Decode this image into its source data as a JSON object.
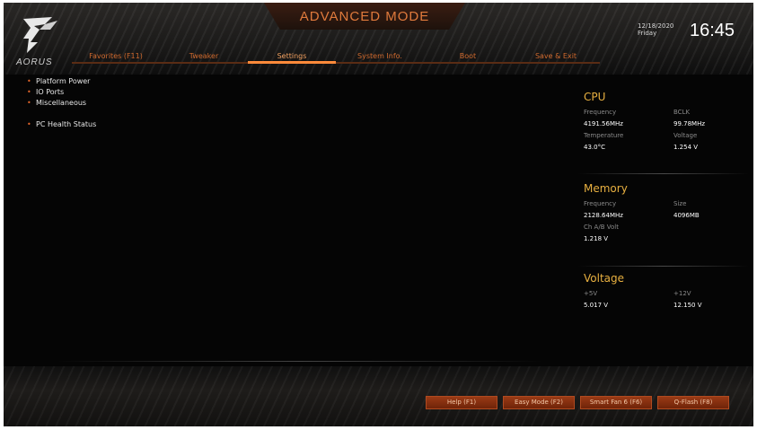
{
  "header": {
    "mode_title": "ADVANCED MODE",
    "brand": "AORUS",
    "date": "12/18/2020",
    "day": "Friday",
    "time": "16:45"
  },
  "tabs": [
    {
      "label": "Favorites (F11)",
      "active": false
    },
    {
      "label": "Tweaker",
      "active": false
    },
    {
      "label": "Settings",
      "active": true
    },
    {
      "label": "System Info.",
      "active": false
    },
    {
      "label": "Boot",
      "active": false
    },
    {
      "label": "Save & Exit",
      "active": false
    }
  ],
  "menu": {
    "items": [
      {
        "label": "Platform Power"
      },
      {
        "label": "IO Ports"
      },
      {
        "label": "Miscellaneous"
      },
      {
        "label": "PC Health Status"
      }
    ]
  },
  "info": {
    "cpu": {
      "title": "CPU",
      "frequency_label": "Frequency",
      "frequency_value": "4191.56MHz",
      "bclk_label": "BCLK",
      "bclk_value": "99.78MHz",
      "temperature_label": "Temperature",
      "temperature_value": "43.0°C",
      "voltage_label": "Voltage",
      "voltage_value": "1.254 V"
    },
    "memory": {
      "title": "Memory",
      "frequency_label": "Frequency",
      "frequency_value": "2128.64MHz",
      "size_label": "Size",
      "size_value": "4096MB",
      "volt_label": "Ch A/B Volt",
      "volt_value": "1.218 V"
    },
    "voltage": {
      "title": "Voltage",
      "v5_label": "+5V",
      "v5_value": "5.017 V",
      "v12_label": "+12V",
      "v12_value": "12.150 V"
    }
  },
  "footer": {
    "help": "Help (F1)",
    "easy_mode": "Easy Mode (F2)",
    "smart_fan": "Smart Fan 6 (F6)",
    "q_flash": "Q-Flash (F8)"
  },
  "colors": {
    "accent_orange": "#e2662b",
    "section_gold": "#e8b040",
    "button_red": "#8a2f0f"
  }
}
